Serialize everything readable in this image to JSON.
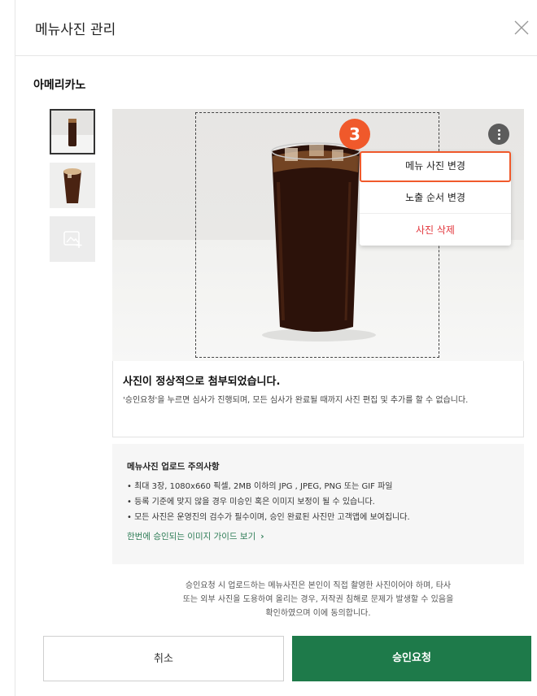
{
  "modal": {
    "title": "메뉴사진 관리",
    "menu_name": "아메리카노"
  },
  "photo_menu": {
    "step_badge": "3",
    "items": [
      "메뉴 사진 변경",
      "노출 순서 변경",
      "사진 삭제"
    ]
  },
  "notice": {
    "title": "사진이 정상적으로 첨부되었습니다.",
    "description": "'승인요청'을 누르면 심사가 진행되며, 모든 심사가 완료될 때까지 사진 편집 및 추가를 할 수 없습니다."
  },
  "caution": {
    "title": "메뉴사진 업로드 주의사항",
    "items": [
      "• 최대 3장, 1080x660 픽셀, 2MB 이하의 JPG , JPEG, PNG 또는 GIF 파일",
      "• 등록 기준에 맞지 않을 경우 미승인 혹은 이미지 보정이 될 수 있습니다.",
      "• 모든 사진은 운영진의 검수가 필수이며, 승인 완료된 사진만 고객앱에 보여집니다."
    ],
    "guide_link": "한번에 승인되는 이미지 가이드 보기",
    "guide_chevron": "›"
  },
  "consent": {
    "lines": [
      "승인요청 시 업로드하는 메뉴사진은 본인이 직접 촬영한 사진이어야 하며, 타사",
      "또는 외부 사진을 도용하여 올리는 경우, 저작권 침해로 문제가 발생할 수 있음을",
      "확인하였으며 이에 동의합니다."
    ]
  },
  "buttons": {
    "cancel": "취소",
    "approve": "승인요청"
  },
  "colors": {
    "accent_orange": "#f0592b",
    "primary_green": "#1e7a4a",
    "delete_red": "#e2363c",
    "link_green": "#2f7d57"
  },
  "icons": [
    "close-icon",
    "more-vertical-icon",
    "add-image-icon",
    "chevron-right-icon"
  ]
}
